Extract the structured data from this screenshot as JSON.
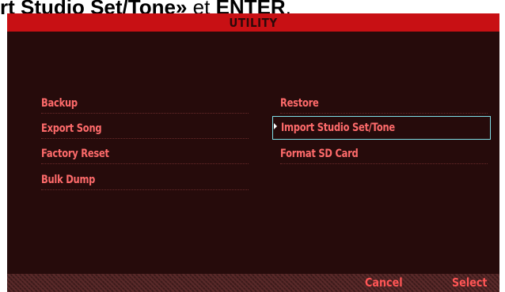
{
  "caption": {
    "text_bold": "rt Studio Set/Tone»",
    "text_after": " et ",
    "text_bold2": "ENTER",
    "text_end": "."
  },
  "screen": {
    "title": "UTILITY",
    "left_menu": [
      "Backup",
      "Export Song",
      "Factory Reset",
      "Bulk Dump"
    ],
    "right_menu": [
      "Restore",
      "Import Studio Set/Tone",
      "Format SD Card"
    ],
    "selected_item": "Import Studio Set/Tone",
    "footer": {
      "cancel_label": "Cancel",
      "select_label": "Select"
    }
  },
  "colors": {
    "title_bar": "#c81014",
    "background": "#260b0b",
    "text": "#ff6b6b",
    "selection_border": "#7fe0e8"
  }
}
